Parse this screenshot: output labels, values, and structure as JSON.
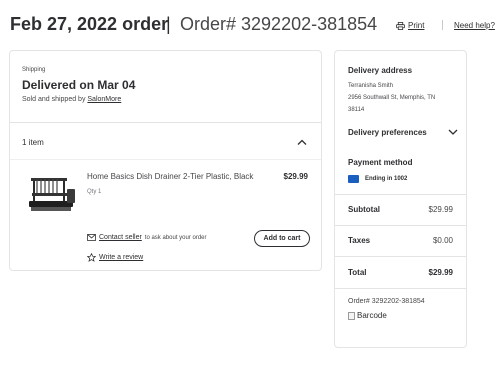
{
  "header": {
    "order_date": "Feb 27, 2022 order",
    "separator": "|",
    "order_number": "Order# 3292202-381854",
    "print_label": "Print",
    "help_label": "Need help?"
  },
  "shipment": {
    "section_label": "Shipping",
    "status": "Delivered on Mar 04",
    "sold_prefix": "Sold and shipped by",
    "seller": "SalonMore",
    "item_count": "1 item"
  },
  "item": {
    "name": "Home Basics Dish Drainer 2-Tier Plastic, Black",
    "price": "$29.99",
    "qty": "Qty 1",
    "contact_link": "Contact seller",
    "contact_suffix": "to ask about your order",
    "add_to_cart": "Add to cart",
    "review_link": "Write a review"
  },
  "summary": {
    "delivery_address_heading": "Delivery address",
    "address_name": "Terranisha Smith",
    "address_line": "2956 Southwall St, Memphis, TN",
    "address_zip": "38114",
    "delivery_preferences": "Delivery preferences",
    "payment_heading": "Payment method",
    "payment_ending": "Ending in 1002",
    "subtotal_label": "Subtotal",
    "subtotal_value": "$29.99",
    "taxes_label": "Taxes",
    "taxes_value": "$0.00",
    "total_label": "Total",
    "total_value": "$29.99",
    "order_ref": "Order# 3292202-381854",
    "barcode_alt": "Barcode"
  },
  "colors": {
    "text_primary": "#2e2f32",
    "border": "#e3e4e5",
    "card_badge": "#1a5fbf"
  }
}
